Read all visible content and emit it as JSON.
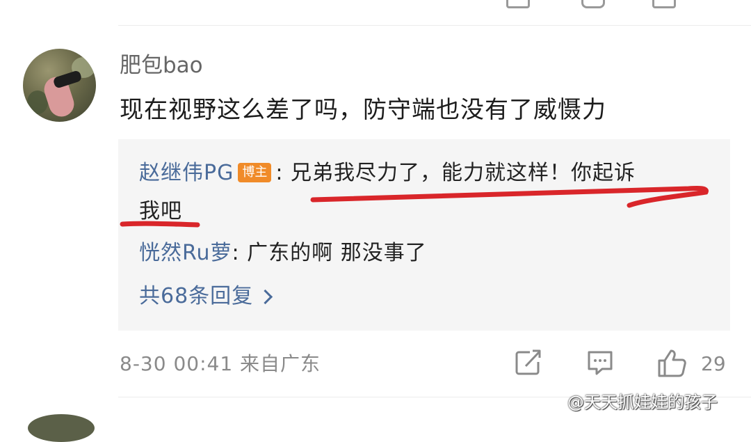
{
  "comment": {
    "username": "肥包bao",
    "text": "现在视野这么差了吗，防守端也没有了威慑力",
    "meta": "8-30 00:41 来自广东",
    "like_count": "29"
  },
  "replies": [
    {
      "name": "赵继伟PG",
      "badge": "博主",
      "text_line1": "兄弟我尽力了，能力就这样！你起诉",
      "text_line2": "我吧"
    },
    {
      "name": "恍然Ru萝",
      "text": "广东的啊 那没事了"
    }
  ],
  "more_replies": "共68条回复",
  "watermark": "@天天抓娃娃的孩子",
  "colors": {
    "link_blue": "#4a6b9a",
    "badge_orange": "#f08b29",
    "annotation_red": "#d9262a",
    "reply_bg": "#f5f5f5",
    "meta_gray": "#8a8a8a"
  },
  "icons": [
    "share-icon",
    "comment-icon",
    "like-icon",
    "weibo-logo-icon"
  ]
}
